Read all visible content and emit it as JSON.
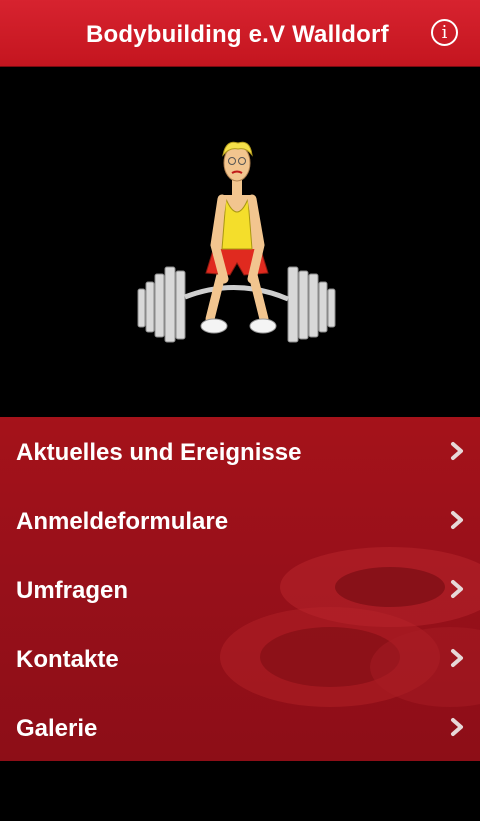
{
  "header": {
    "title": "Bodybuilding e.V Walldorf",
    "info_icon": "info-icon",
    "info_glyph": "i"
  },
  "hero": {
    "illustration": "weightlifter-cartoon"
  },
  "menu": {
    "items": [
      {
        "label": "Aktuelles und Ereignisse",
        "icon": "chevron-right-icon"
      },
      {
        "label": "Anmeldeformulare",
        "icon": "chevron-right-icon"
      },
      {
        "label": "Umfragen",
        "icon": "chevron-right-icon"
      },
      {
        "label": "Kontakte",
        "icon": "chevron-right-icon"
      },
      {
        "label": "Galerie",
        "icon": "chevron-right-icon"
      }
    ]
  },
  "colors": {
    "header": "#d01d28",
    "menu_background": "#9a111a",
    "page_background": "#000000",
    "text": "#ffffff"
  }
}
